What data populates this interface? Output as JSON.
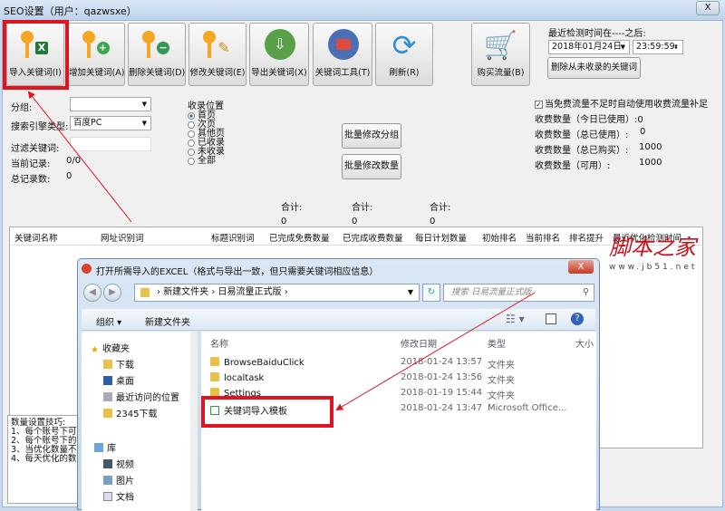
{
  "window": {
    "title": "SEO设置（用户：qazwsxe）",
    "close": "X"
  },
  "toolbar": [
    {
      "label": "导入关键词(I)",
      "icon": "key-excel-icon"
    },
    {
      "label": "增加关键词(A)",
      "icon": "key-add-icon"
    },
    {
      "label": "删除关键词(D)",
      "icon": "key-remove-icon"
    },
    {
      "label": "修改关键词(E)",
      "icon": "key-edit-icon"
    },
    {
      "label": "导出关键词(X)",
      "icon": "export-icon"
    },
    {
      "label": "关键词工具(T)",
      "icon": "toolbox-icon"
    },
    {
      "label": "刷新(R)",
      "icon": "refresh-icon"
    },
    {
      "label": "购买流量(B)",
      "icon": "cart-icon"
    }
  ],
  "check_time": {
    "label": "最近检测时间在----之后:",
    "date": "2018年01月24日",
    "time": "23:59:59",
    "delete_button": "删除从未收录的关键词"
  },
  "filters": {
    "group_label": "分组:",
    "group_value": "",
    "engine_label": "搜索引擎类型:",
    "engine_value": "百度PC",
    "keyword_label": "过滤关键词:",
    "keyword_value": "",
    "current_label": "当前记录:",
    "current_value": "0/0",
    "total_label": "总记录数:",
    "total_value": "0"
  },
  "index_position": {
    "label": "收录位置",
    "options": [
      "首页",
      "次页",
      "其他页",
      "已收录",
      "未收录",
      "全部"
    ],
    "selected": 0
  },
  "batch": {
    "group": "批量修改分组",
    "count": "批量修改数量"
  },
  "paid": {
    "auto_label": "当免费流量不足时自动使用收费流量补足",
    "auto_checked": true,
    "rows": [
      {
        "label": "收费数量（今日已使用）:",
        "value": "0"
      },
      {
        "label": "收费数量（总已使用）:",
        "value": "0"
      },
      {
        "label": "收费数量（总已购买）:",
        "value": "1000"
      },
      {
        "label": "收费数量（可用）:",
        "value": "1000"
      }
    ]
  },
  "totals": [
    {
      "label": "合计:",
      "value": "0"
    },
    {
      "label": "合计:",
      "value": "0"
    },
    {
      "label": "合计:",
      "value": "0"
    }
  ],
  "table": {
    "columns": [
      "关键词名称",
      "网址识别词",
      "标题识别词",
      "已完成免费数量",
      "已完成收费数量",
      "每日计划数量",
      "初始排名",
      "当前排名",
      "排名提升",
      "最近优化检测时间"
    ]
  },
  "tips": {
    "title": "数量设置技巧:",
    "lines": [
      "1、每个账号下可",
      "2、每个账号下的",
      "3、当优化数量不",
      "4、每天优化的数"
    ]
  },
  "watermark": {
    "main": "脚本之家",
    "url": "www.jb51.net"
  },
  "dialog": {
    "title": "打开所需导入的EXCEL（格式与导出一致，但只需要关键词相应信息）",
    "close": "X",
    "path": [
      "新建文件夹",
      "日易流量正式版"
    ],
    "search_placeholder": "搜索 日易流量正式版",
    "organize": "组织 ▾",
    "new_folder": "新建文件夹",
    "nav": [
      {
        "label": "收藏夹",
        "icon": "star-icon"
      },
      {
        "label": "下载",
        "icon": "download-folder-icon"
      },
      {
        "label": "桌面",
        "icon": "desktop-icon"
      },
      {
        "label": "最近访问的位置",
        "icon": "recent-icon"
      },
      {
        "label": "2345下载",
        "icon": "folder-icon"
      },
      {
        "label": "库",
        "icon": "library-icon"
      },
      {
        "label": "视频",
        "icon": "video-icon"
      },
      {
        "label": "图片",
        "icon": "picture-icon"
      },
      {
        "label": "文档",
        "icon": "document-icon"
      }
    ],
    "columns": [
      "名称",
      "修改日期",
      "类型",
      "大小"
    ],
    "files": [
      {
        "name": "BrowseBaiduClick",
        "date": "2018-01-24 13:57",
        "type": "文件夹"
      },
      {
        "name": "localtask",
        "date": "2018-01-24 13:56",
        "type": "文件夹"
      },
      {
        "name": "Settings",
        "date": "2018-01-19 15:44",
        "type": "文件夹"
      },
      {
        "name": "关键词导入模板",
        "date": "2018-01-24 13:47",
        "type": "Microsoft Office..."
      }
    ]
  },
  "colors": {
    "highlight": "#e0141e",
    "accent": "#2a62c9"
  }
}
